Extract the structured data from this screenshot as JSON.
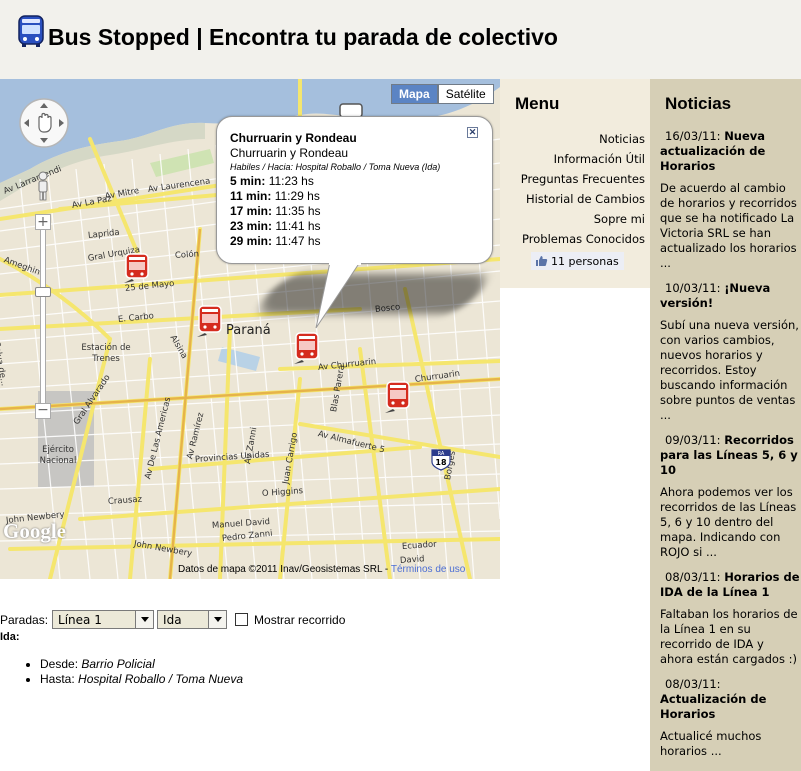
{
  "site": {
    "title": "Bus Stopped | Encontra tu parada de colectivo",
    "logo_icon": "bus-icon"
  },
  "map": {
    "type_buttons": {
      "map": "Mapa",
      "satellite": "Satélite"
    },
    "city_label": "Paraná",
    "streets": {
      "laurencena": "Av Laurencena",
      "mitre": "Av Mitre",
      "la_paz": "Av La Paz",
      "laprida": "Laprida",
      "gral_urquiza": "Gral Urquiza",
      "larramendi": "Av Larramendi",
      "ameghino": "Ameghino",
      "colon": "Colón",
      "cinco_mayo": "25 de Mayo",
      "e_carbo": "E. Carbo",
      "selva": "Selva de...",
      "alsina": "Alsina",
      "churruarin": "Av Churruarin",
      "churruarin2": "Churruarin",
      "bosco": "Bosco",
      "blas_parera": "Blas Parera",
      "almafuerte": "Av Almafuerte 5",
      "ramirez": "Av Ramírez",
      "americas": "Av De Las Americas",
      "carrigo": "Juan Carrigo",
      "provincias": "Provincias Unidas",
      "zanni": "Av Zanni",
      "gral_alvarado": "Gral Alvarado",
      "ohiggins": "O Higgins",
      "crausaz": "Crausaz",
      "john_newbery": "John Newbery",
      "john_newbery2": "John Newbery",
      "pedro_zanni": "Pedro Zanni",
      "manuel_david": "Manuel David",
      "david": "David",
      "borges": "Borges",
      "ecuador": "Ecuador"
    },
    "places": {
      "estacion": "Estación de Trenes",
      "ejercito": "Ejército Nacional"
    },
    "route_shield": {
      "top": "RA",
      "number": "18"
    },
    "infowindow": {
      "title": "Churruarin y Rondeau",
      "subtitle": "Churruarin y Rondeau",
      "direction": "Habiles / Hacia: Hospital Roballo / Toma Nueva (Ida)",
      "arrivals": [
        {
          "min": "5 min:",
          "time": "11:23 hs"
        },
        {
          "min": "11 min:",
          "time": "11:29 hs"
        },
        {
          "min": "17 min:",
          "time": "11:35 hs"
        },
        {
          "min": "23 min:",
          "time": "11:41 hs"
        },
        {
          "min": "29 min:",
          "time": "11:47 hs"
        }
      ]
    },
    "attribution": "Datos de mapa ©2011 Inav/Geosistemas SRL -",
    "terms_link": "Términos de uso",
    "google_logo": "Google"
  },
  "controls": {
    "paradas_label": "Paradas:",
    "line_select": "Línea 1",
    "direction_select": "Ida",
    "show_route_label": "Mostrar recorrido"
  },
  "route": {
    "heading": "Ida:",
    "from_label": "Desde:",
    "from_value": "Barrio Policial",
    "to_label": "Hasta:",
    "to_value": "Hospital Roballo / Toma Nueva"
  },
  "menu": {
    "title": "Menu",
    "items": [
      "Noticias",
      "Información Útil",
      "Preguntas Frecuentes",
      "Historial de Cambios",
      "Sopre mi",
      "Problemas Conocidos"
    ],
    "like": "11 personas"
  },
  "news": {
    "title": "Noticias",
    "items": [
      {
        "date": "16/03/11:",
        "title": "Nueva actualización de Horarios",
        "body": "De acuerdo al cambio de horarios y recorridos que se  ha notificado La Victoria SRL se han actualizado los horarios ..."
      },
      {
        "date": "10/03/11:",
        "title": "¡Nueva versión!",
        "body": "Subí una nueva versión, con varios cambios, nuevos horarios y recorridos. Estoy buscando información sobre puntos de ventas ..."
      },
      {
        "date": "09/03/11:",
        "title": "Recorridos para las Líneas 5, 6 y 10",
        "body": "Ahora podemos ver los recorridos de las Líneas 5, 6 y 10 dentro del mapa. Indicando con ROJO si ..."
      },
      {
        "date": "08/03/11:",
        "title": "Horarios de IDA de la Línea 1",
        "body": "Faltaban los horarios de la Línea 1 en su recorrido de IDA y ahora están cargados :)"
      },
      {
        "date": "08/03/11:",
        "title": "Actualización de Horarios",
        "body": "Actualicé muchos horarios ..."
      }
    ]
  },
  "colors": {
    "header_bg": "#f2f1ec",
    "menu_bg": "#f2ecdd",
    "news_bg": "#d6cfb6",
    "map_land": "#ece6d6",
    "river": "#a5bfdd",
    "road_major": "#f5e66e",
    "bus_red": "#d52b1e"
  }
}
